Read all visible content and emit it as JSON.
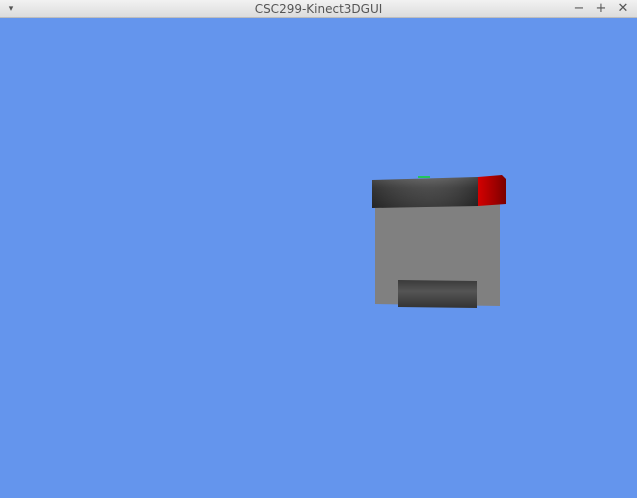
{
  "window": {
    "title": "CSC299-Kinect3DGUI",
    "menu_glyph": "▾",
    "minimize_glyph": "−",
    "maximize_glyph": "+",
    "close_glyph": "✕"
  },
  "scene": {
    "background_color": "#6495ED",
    "panel_color": "#808080",
    "top_bar_color": "#3c3c3c",
    "bottom_bar_color": "#4a4a4a",
    "red_block_color": "#b00000",
    "green_marker_color": "#22c55e"
  }
}
